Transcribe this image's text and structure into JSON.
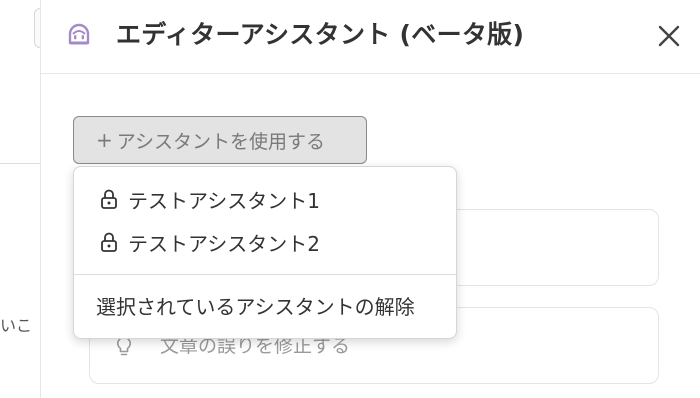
{
  "background": {
    "partial_text": "いこ"
  },
  "panel": {
    "title": "エディターアシスタント (ベータ版)",
    "use_assistant_button": {
      "plus": "+",
      "label": "アシスタントを使用する"
    },
    "cards": [
      {
        "label": ""
      },
      {
        "label": "文章の誤りを修正する",
        "icon": "lightbulb-icon"
      }
    ]
  },
  "menu": {
    "items": [
      {
        "label": "テストアシスタント1",
        "icon": "lock-icon"
      },
      {
        "label": "テストアシスタント2",
        "icon": "lock-icon"
      }
    ],
    "clear_label": "選択されているアシスタントの解除"
  },
  "colors": {
    "accent_icon": "#a48bc8",
    "button_bg": "#e3e3e3",
    "text": "#333333"
  }
}
